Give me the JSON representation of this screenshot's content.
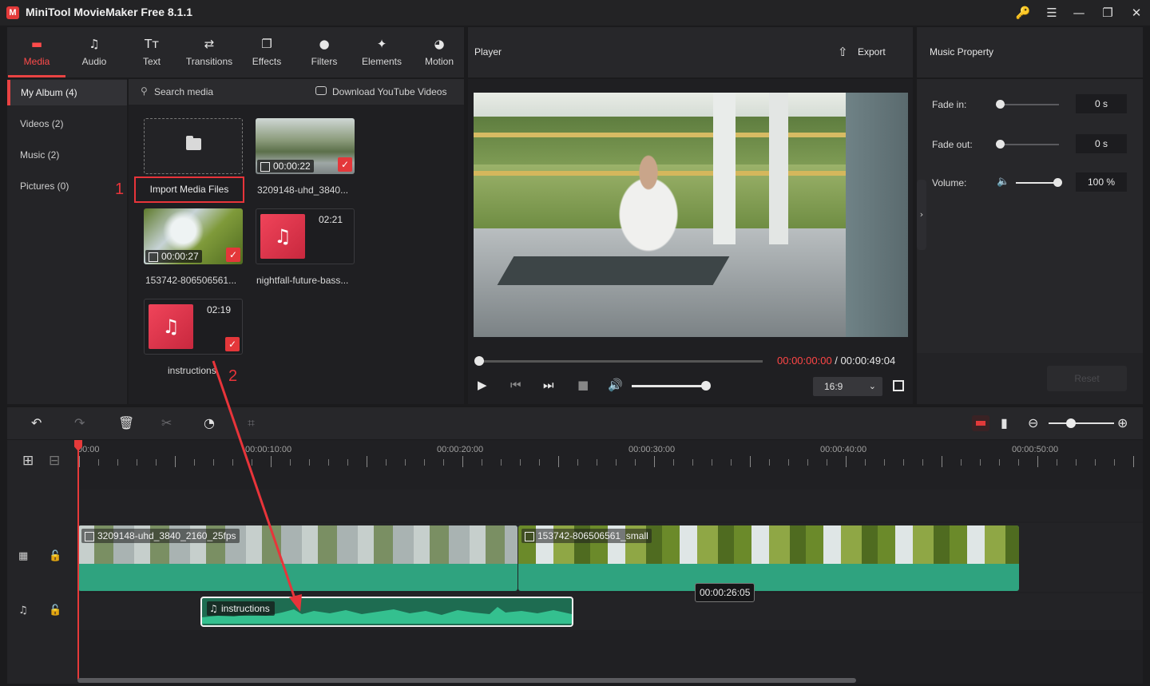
{
  "app": {
    "title": "MiniTool MovieMaker Free 8.1.1",
    "logo": "M"
  },
  "window_controls": {
    "key": "🔑",
    "menu": "☰",
    "minimize": "—",
    "maximize": "❐",
    "close": "✕"
  },
  "top_tabs": [
    {
      "label": "Media",
      "icon": "media-icon",
      "glyph": "▬",
      "active": true
    },
    {
      "label": "Audio",
      "icon": "music-note-icon",
      "glyph": "♫"
    },
    {
      "label": "Text",
      "icon": "text-icon",
      "glyph": "Tт"
    },
    {
      "label": "Transitions",
      "icon": "transitions-icon",
      "glyph": "⇄"
    },
    {
      "label": "Effects",
      "icon": "effects-icon",
      "glyph": "❐"
    },
    {
      "label": "Filters",
      "icon": "filters-icon",
      "glyph": "●"
    },
    {
      "label": "Elements",
      "icon": "elements-icon",
      "glyph": "✦"
    },
    {
      "label": "Motion",
      "icon": "motion-icon",
      "glyph": "◕"
    }
  ],
  "sidebar": {
    "items": [
      {
        "label": "My Album (4)",
        "active": true
      },
      {
        "label": "Videos (2)"
      },
      {
        "label": "Music (2)"
      },
      {
        "label": "Pictures (0)"
      }
    ]
  },
  "media": {
    "search_label": "Search media",
    "download_label": "Download YouTube Videos",
    "import_label": "Import Media Files",
    "annotation_1": "1",
    "annotation_2": "2",
    "items": [
      {
        "name": "3209148-uhd_3840...",
        "duration": "00:00:22",
        "type": "video"
      },
      {
        "name": "153742-806506561...",
        "duration": "00:00:27",
        "type": "video"
      },
      {
        "name": "nightfall-future-bass...",
        "duration": "02:21",
        "type": "music"
      },
      {
        "name": "instructions",
        "duration": "02:19",
        "type": "music"
      }
    ],
    "check_glyph": "✓",
    "music_glyph": "♫"
  },
  "player": {
    "title": "Player",
    "export_label": "Export",
    "current_time": "00:00:00:00",
    "total_time": " / 00:00:49:04",
    "aspect_ratio": "16:9",
    "volume": 0.95,
    "progress": 0.0
  },
  "properties": {
    "title": "Music Property",
    "fade_in_label": "Fade in:",
    "fade_in_value": "0 s",
    "fade_out_label": "Fade out:",
    "fade_out_value": "0 s",
    "volume_label": "Volume:",
    "volume_value": "100 %",
    "reset_label": "Reset"
  },
  "timeline": {
    "ruler_labels": [
      "00:00",
      "00:00:10:00",
      "00:00:20:00",
      "00:00:30:00",
      "00:00:40:00",
      "00:00:50:00"
    ],
    "clips": [
      {
        "name": "3209148-uhd_3840_2160_25fps",
        "track": "video"
      },
      {
        "name": "153742-806506561_small",
        "track": "video"
      }
    ],
    "audio_clip": {
      "name": "instructions"
    },
    "tooltip": "00:00:26:05"
  },
  "colors": {
    "accent": "#e94343",
    "clip": "#2fa37f",
    "audio": "#1e6c51"
  }
}
